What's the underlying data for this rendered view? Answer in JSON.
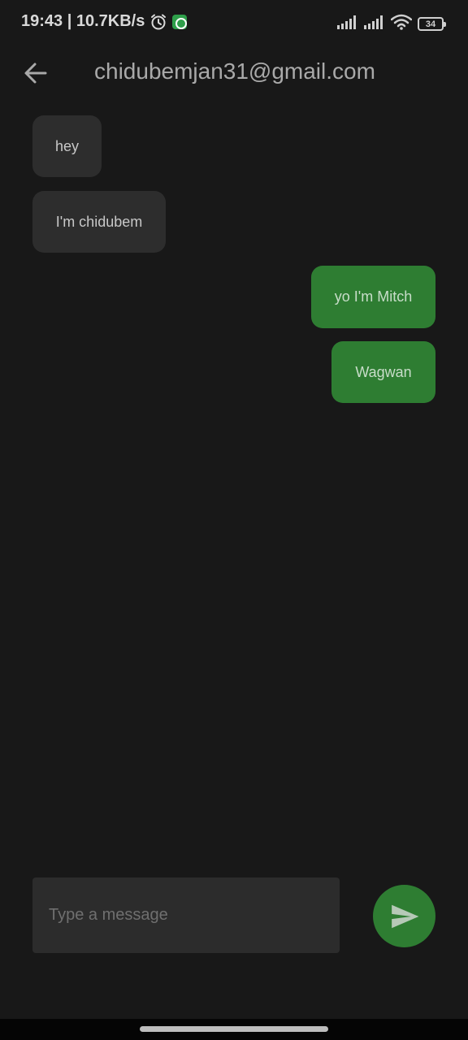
{
  "status_bar": {
    "time_and_speed": "19:43 | 10.7KB/s",
    "battery": "34",
    "icons": [
      "alarm-icon",
      "whatsapp-icon",
      "signal-icon",
      "signal-icon",
      "wifi-icon",
      "battery-icon"
    ]
  },
  "app_bar": {
    "title": "chidubemjan31@gmail.com",
    "back_icon": "arrow-left-icon"
  },
  "messages": [
    {
      "text": "hey",
      "direction": "incoming"
    },
    {
      "text": "I'm chidubem",
      "direction": "incoming"
    },
    {
      "text": "yo I'm Mitch",
      "direction": "outgoing"
    },
    {
      "text": "Wagwan",
      "direction": "outgoing"
    }
  ],
  "composer": {
    "placeholder": "Type a message",
    "value": "",
    "send_icon": "send-icon"
  },
  "colors": {
    "background": "#181818",
    "incoming_bubble": "#2d2d2d",
    "outgoing_bubble": "#2e7d32",
    "input_background": "#2c2c2c"
  }
}
